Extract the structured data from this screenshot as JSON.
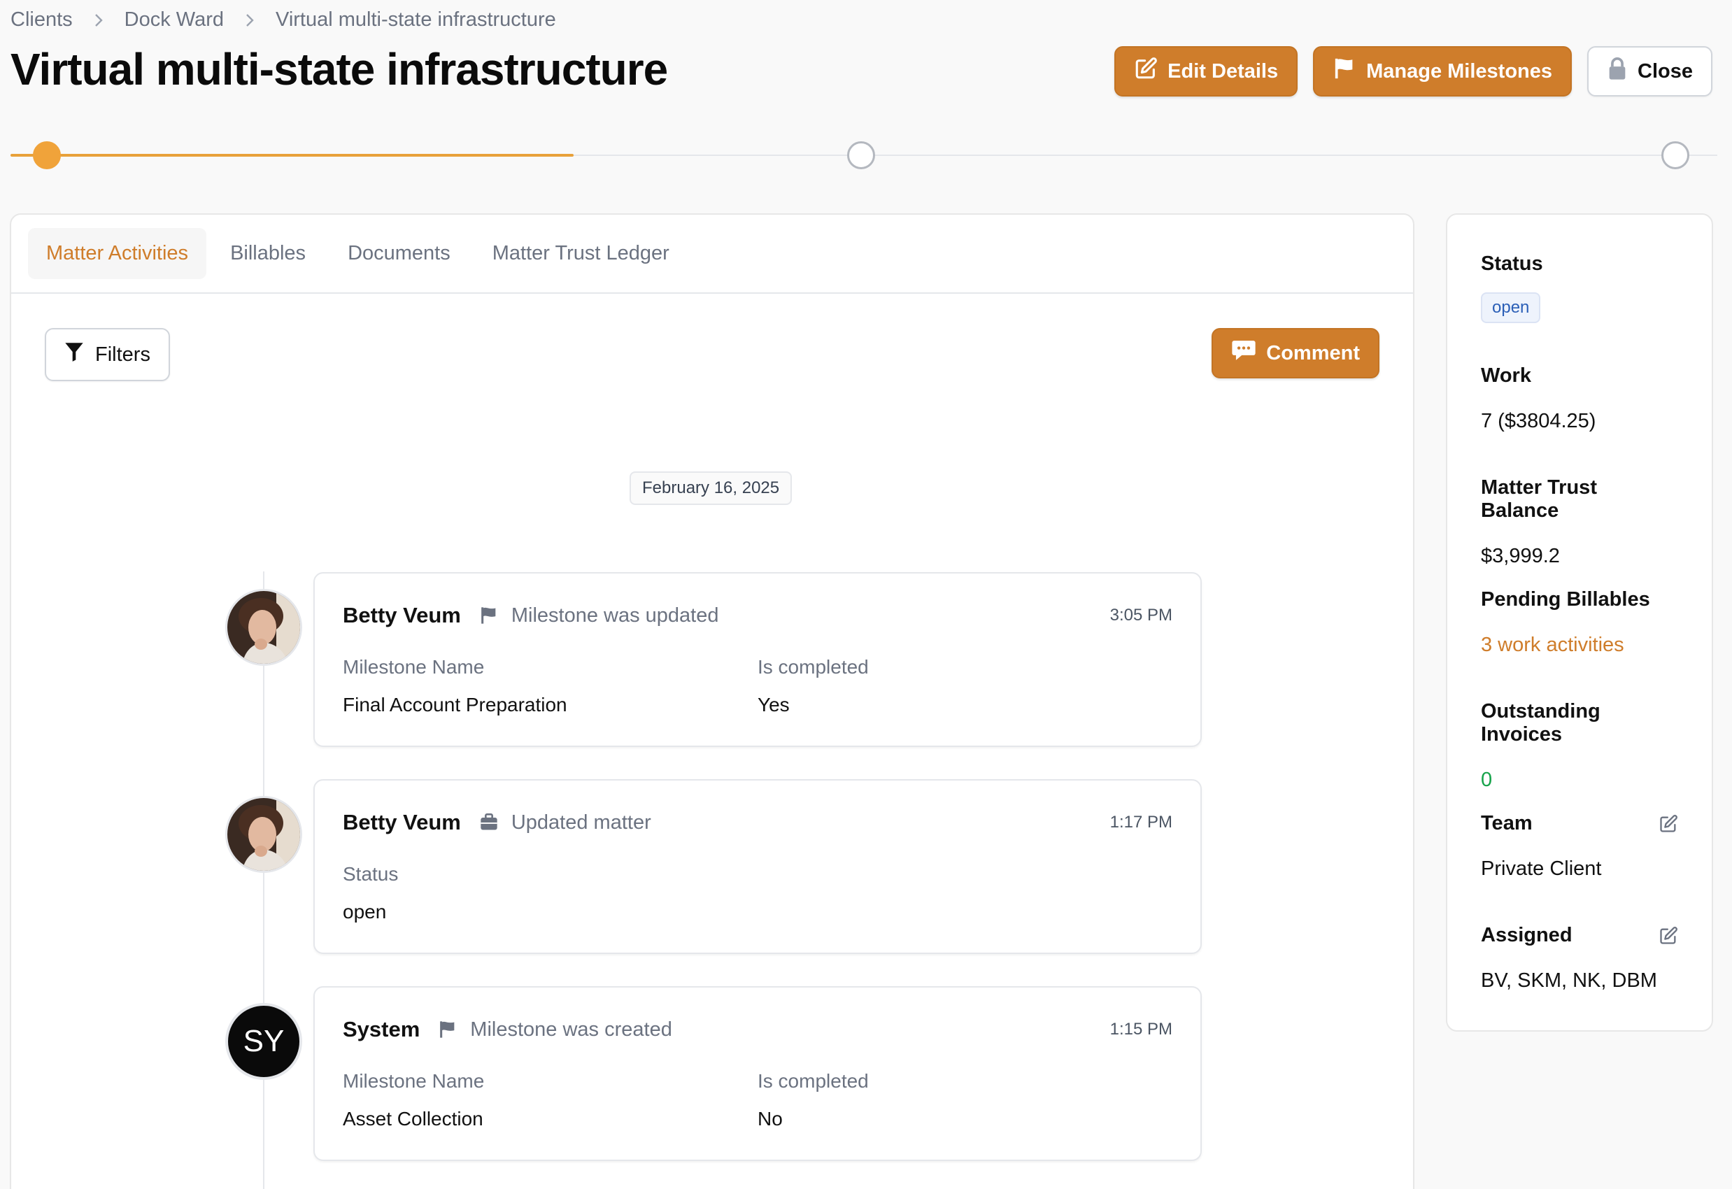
{
  "breadcrumb": [
    "Clients",
    "Dock Ward",
    "Virtual multi-state infrastructure"
  ],
  "title": "Virtual multi-state infrastructure",
  "actions": {
    "edit": "Edit Details",
    "milestones": "Manage Milestones",
    "close": "Close"
  },
  "progress": {
    "completed_fraction": 0.33,
    "milestones_total": 3,
    "milestones_done": 1
  },
  "tabs": [
    "Matter Activities",
    "Billables",
    "Documents",
    "Matter Trust Ledger"
  ],
  "active_tab": "Matter Activities",
  "toolbar": {
    "filters": "Filters",
    "comment": "Comment"
  },
  "date_divider": "February 16, 2025",
  "activities": [
    {
      "user": "Betty Veum",
      "icon": "flag-icon",
      "title": "Milestone was updated",
      "time": "3:05 PM",
      "fields": [
        {
          "label": "Milestone Name",
          "value": "Final Account Preparation"
        },
        {
          "label": "Is completed",
          "value": "Yes"
        }
      ]
    },
    {
      "user": "Betty Veum",
      "icon": "briefcase-icon",
      "title": "Updated matter",
      "time": "1:17 PM",
      "fields": [
        {
          "label": "Status",
          "value": "open"
        }
      ]
    },
    {
      "user": "System",
      "initials": "SY",
      "icon": "flag-icon",
      "title": "Milestone was created",
      "time": "1:15 PM",
      "fields": [
        {
          "label": "Milestone Name",
          "value": "Asset Collection"
        },
        {
          "label": "Is completed",
          "value": "No"
        }
      ]
    }
  ],
  "sidebar": {
    "status": {
      "label": "Status",
      "value": "open"
    },
    "work": {
      "label": "Work",
      "value": "7 ($3804.25)"
    },
    "trust": {
      "label": "Matter Trust Balance",
      "value": "$3,999.2"
    },
    "pending": {
      "label": "Pending Billables",
      "value": "3 work activities"
    },
    "invoices": {
      "label": "Outstanding Invoices",
      "value": "0"
    },
    "team": {
      "label": "Team",
      "value": "Private Client"
    },
    "assigned": {
      "label": "Assigned",
      "value": "BV, SKM, NK, DBM"
    }
  },
  "colors": {
    "accent": "#cf7d2b",
    "progress": "#f0a33a",
    "success": "#16a34a",
    "badge": "#2b5fb7"
  }
}
